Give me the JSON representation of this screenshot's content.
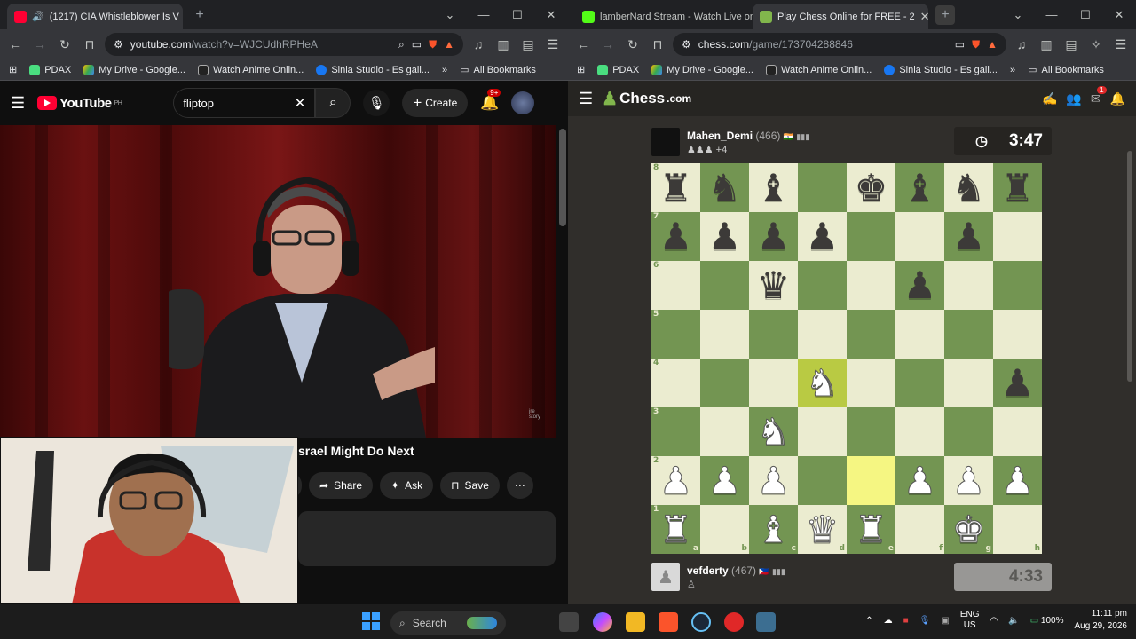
{
  "left_browser": {
    "tab_title": "(1217) CIA Whistleblower Is V",
    "url": "youtube.com",
    "url_path": "/watch?v=WJCUdhRPHeA",
    "bookmarks": [
      "PDAX",
      "My Drive - Google...",
      "Watch Anime Onlin...",
      "Sinla Studio - Es gali..."
    ],
    "all_bookmarks": "All Bookmarks"
  },
  "youtube": {
    "logo": "YouTube",
    "region": "PH",
    "search_value": "fliptop",
    "create_label": "Create",
    "notif_count": "9+",
    "video_title": "srael Might Do Next",
    "share_label": "Share",
    "ask_label": "Ask",
    "save_label": "Save",
    "watermark": "jre story"
  },
  "right_browser": {
    "tab1_title": "lamberNard Stream - Watch Live on",
    "tab2_title": "Play Chess Online for FREE - 2",
    "url": "chess.com",
    "url_path": "/game/173704288846",
    "bookmarks": [
      "PDAX",
      "My Drive - Google...",
      "Watch Anime Onlin...",
      "Sinla Studio - Es gali..."
    ],
    "all_bookmarks": "All Bookmarks"
  },
  "chess": {
    "logo": "Chess",
    "logo_suffix": ".com",
    "mail_count": "1",
    "opponent": {
      "name": "Mahen_Demi",
      "rating": "(466)",
      "captured": "+4",
      "clock": "3:47"
    },
    "player": {
      "name": "vefderty",
      "rating": "(467)",
      "clock": "4:33"
    },
    "board": [
      [
        "br",
        "bn",
        "bb",
        "",
        "bk",
        "bb",
        "bn",
        "br"
      ],
      [
        "bp",
        "bp",
        "bp",
        "bp",
        "",
        "",
        "bp",
        ""
      ],
      [
        "",
        "",
        "bq",
        "",
        "",
        "bp",
        "",
        ""
      ],
      [
        "",
        "",
        "",
        "",
        "",
        "",
        "",
        ""
      ],
      [
        "",
        "",
        "",
        "wn",
        "",
        "",
        "",
        "bp"
      ],
      [
        "",
        "",
        "wn",
        "",
        "",
        "",
        "",
        ""
      ],
      [
        "wp",
        "wp",
        "wp",
        "",
        "",
        "wp",
        "wp",
        "wp"
      ],
      [
        "wr",
        "",
        "wb",
        "wq",
        "wr",
        "",
        "wk",
        ""
      ]
    ],
    "highlights": [
      "d4",
      "e2"
    ],
    "files": [
      "a",
      "b",
      "c",
      "d",
      "e",
      "f",
      "g",
      "h"
    ],
    "ranks": [
      "8",
      "7",
      "6",
      "5",
      "4",
      "3",
      "2",
      "1"
    ]
  },
  "taskbar": {
    "search_label": "Search",
    "lang1": "ENG",
    "lang2": "US",
    "battery": "100%",
    "time": "11:11 pm",
    "date": "Aug 29, 2026"
  }
}
